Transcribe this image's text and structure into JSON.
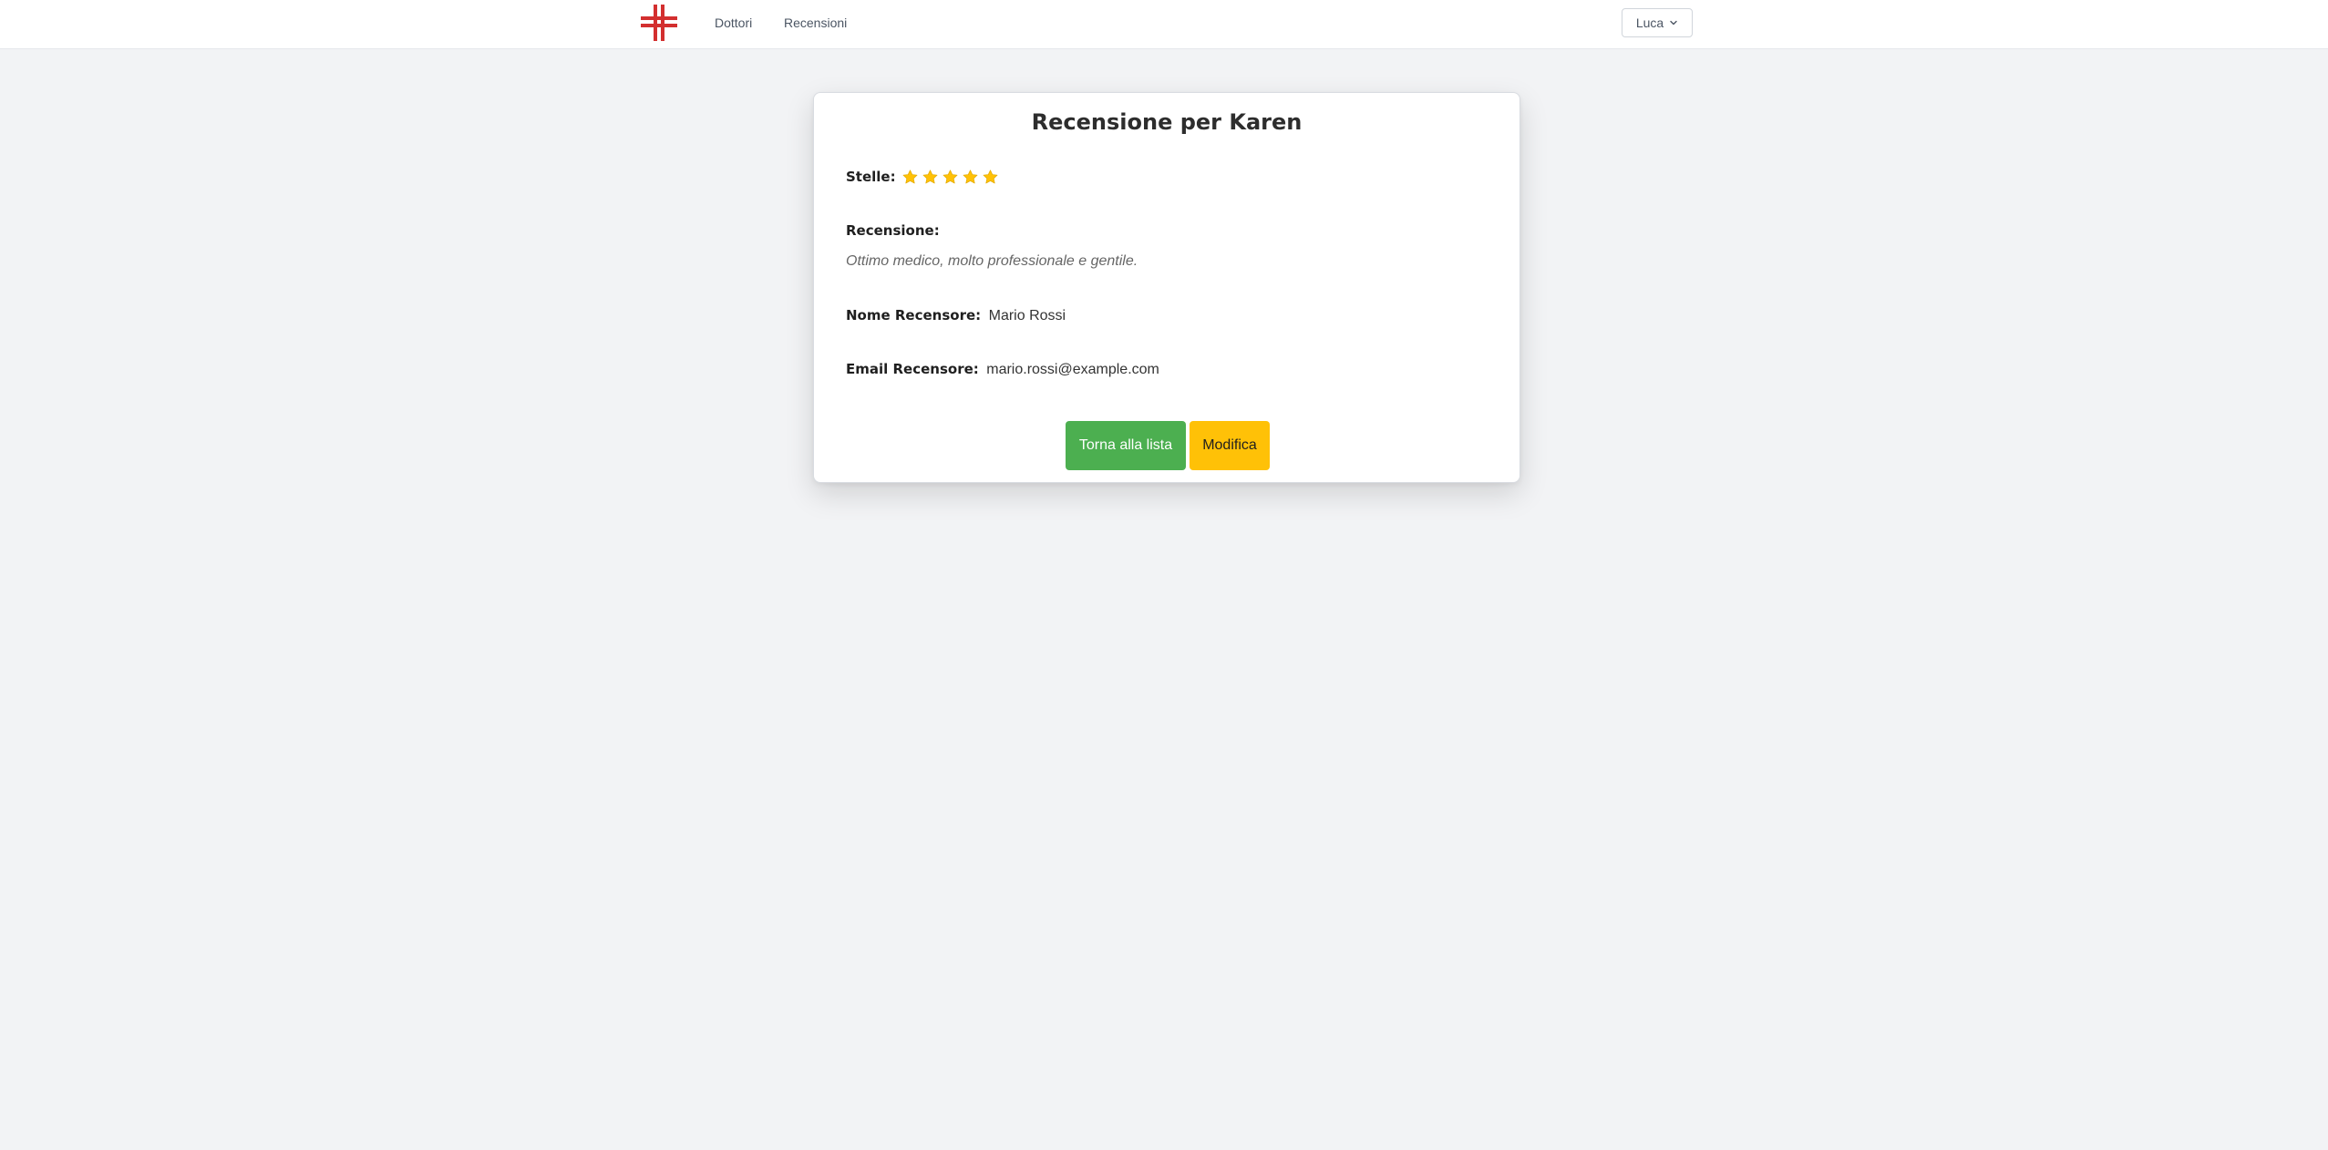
{
  "nav": {
    "logo": "medical-cross-logo",
    "links": [
      {
        "label": "Dottori"
      },
      {
        "label": "Recensioni"
      }
    ],
    "user": {
      "label": "Luca",
      "icon": "chevron-down-icon"
    }
  },
  "review": {
    "title": "Recensione per Karen",
    "stars_label": "Stelle:",
    "rating": 5,
    "rating_max": 5,
    "review_label": "Recensione:",
    "review_text": "Ottimo medico, molto professionale e gentile.",
    "name_label": "Nome Recensore:",
    "name_value": "Mario Rossi",
    "email_label": "Email Recensore:",
    "email_value": "mario.rossi@example.com"
  },
  "actions": {
    "back_label": "Torna alla lista",
    "edit_label": "Modifica"
  },
  "colors": {
    "logo": "#d32f2f",
    "star": "#ffc107",
    "back_button": "#4caf50",
    "edit_button": "#ffc107",
    "page_background": "#f2f3f5"
  }
}
